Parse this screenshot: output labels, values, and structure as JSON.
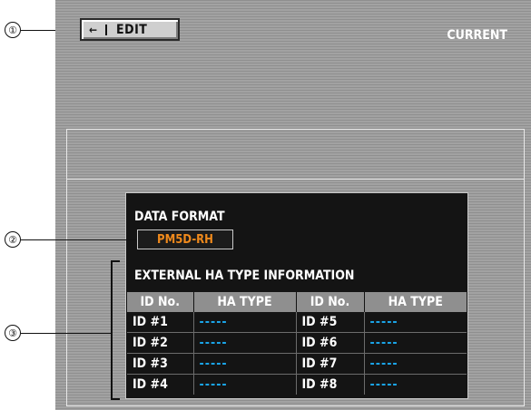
{
  "toolbar": {
    "back_arrow": "←",
    "edit_label": "EDIT"
  },
  "header": {
    "current_label": "CURRENT"
  },
  "data_format": {
    "label": "DATA FORMAT",
    "value": "PM5D-RH"
  },
  "external_ha": {
    "title": "EXTERNAL HA TYPE INFORMATION",
    "columns": [
      "ID No.",
      "HA TYPE",
      "ID No.",
      "HA TYPE"
    ],
    "rows": [
      [
        "ID #1",
        "-----",
        "ID #5",
        "-----"
      ],
      [
        "ID #2",
        "-----",
        "ID #6",
        "-----"
      ],
      [
        "ID #3",
        "-----",
        "ID #7",
        "-----"
      ],
      [
        "ID #4",
        "-----",
        "ID #8",
        "-----"
      ]
    ]
  },
  "callouts": [
    "①",
    "②",
    "③"
  ],
  "colors": {
    "accent_orange": "#f08a1c",
    "value_blue": "#1aa4e8"
  }
}
